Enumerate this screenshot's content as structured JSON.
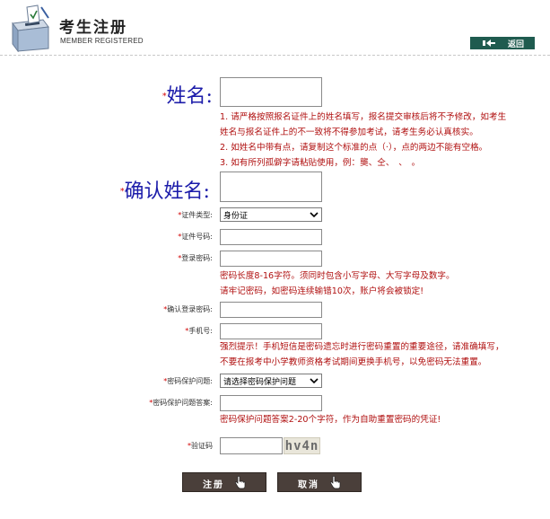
{
  "header": {
    "title": "考生注册",
    "subtitle": "MEMBER REGISTERED",
    "back_label": "返回"
  },
  "form": {
    "name": {
      "label": "姓名:",
      "value": "",
      "notes": [
        "1. 请严格按照报名证件上的姓名填写，报名提交审核后将不予修改，如考生",
        "姓名与报名证件上的不一致将不得参加考试，请考生务必认真核实。",
        "2. 如姓名中带有点，请复制这个标准的点（·），点的两边不能有空格。",
        "3. 如有所列孤僻字请粘贴使用，例：龑、仝、　、　。"
      ]
    },
    "confirm_name": {
      "label": "确认姓名:",
      "value": ""
    },
    "id_type": {
      "label": "证件类型:",
      "selected": "身份证"
    },
    "id_number": {
      "label": "证件号码:",
      "value": ""
    },
    "password": {
      "label": "登录密码:",
      "value": "",
      "notes": [
        "密码长度8-16字符。须同时包含小写字母、大写字母及数字。",
        "请牢记密码，如密码连续输错10次，账户将会被锁定!"
      ]
    },
    "confirm_password": {
      "label": "确认登录密码:",
      "value": ""
    },
    "phone": {
      "label": "手机号:",
      "value": "",
      "notes": [
        "强烈提示！手机短信是密码遗忘时进行密码重置的重要途径，请准确填写，",
        "不要在报考中小学教师资格考试期间更换手机号，以免密码无法重置。"
      ]
    },
    "security_question": {
      "label": "密码保护问题:",
      "selected": "请选择密码保护问题"
    },
    "security_answer": {
      "label": "密码保护问题答案:",
      "value": "",
      "notes": [
        "密码保护问题答案2-20个字符，作为自助重置密码的凭证!"
      ]
    },
    "captcha": {
      "label": "验证码",
      "value": "",
      "image_text": "hv4n"
    }
  },
  "buttons": {
    "register": "注册",
    "cancel": "取消"
  },
  "colors": {
    "note_red": "#b01010",
    "label_blue": "#1c1caa",
    "button_bg": "#4a3f3a",
    "back_bg": "#1f5b4f"
  },
  "icons": {
    "logo": "ballot-box-icon",
    "back": "back-arrow-icon",
    "pointer": "hand-pointer-icon"
  }
}
